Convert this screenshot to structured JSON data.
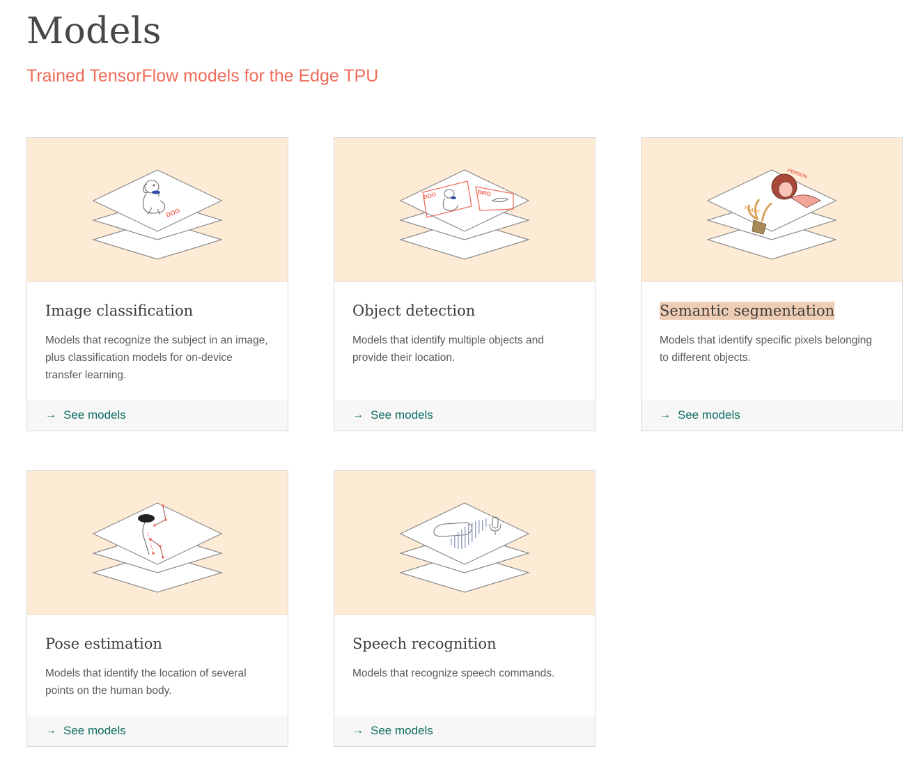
{
  "header": {
    "title": "Models",
    "subtitle": "Trained TensorFlow models for the Edge TPU"
  },
  "cards": [
    {
      "title": "Image classification",
      "description": "Models that recognize the subject in an image, plus classification models for on-device transfer learning.",
      "link_label": "See models",
      "illustration": "image-classification-illustration",
      "art_labels": [
        "DOG"
      ]
    },
    {
      "title": "Object detection",
      "description": "Models that identify multiple objects and provide their location.",
      "link_label": "See models",
      "illustration": "object-detection-illustration",
      "art_labels": [
        "DOG",
        "BIRD"
      ]
    },
    {
      "title": "Semantic segmentation",
      "description": "Models that identify specific pixels belonging to different objects.",
      "link_label": "See models",
      "illustration": "semantic-segmentation-illustration",
      "art_labels": [
        "PERSON",
        "PLANT"
      ]
    },
    {
      "title": "Pose estimation",
      "description": "Models that identify the location of several points on the human body.",
      "link_label": "See models",
      "illustration": "pose-estimation-illustration",
      "art_labels": []
    },
    {
      "title": "Speech recognition",
      "description": "Models that recognize speech commands.",
      "link_label": "See models",
      "illustration": "speech-recognition-illustration",
      "art_labels": []
    }
  ],
  "colors": {
    "accent_subtitle": "#f06c5a",
    "link": "#0b6b5e",
    "card_art_bg": "#fdebd6",
    "highlight": "#efcdb4",
    "footer_bg": "#f7f7f7"
  },
  "icons": {
    "link_arrow": "arrow-right-icon"
  }
}
